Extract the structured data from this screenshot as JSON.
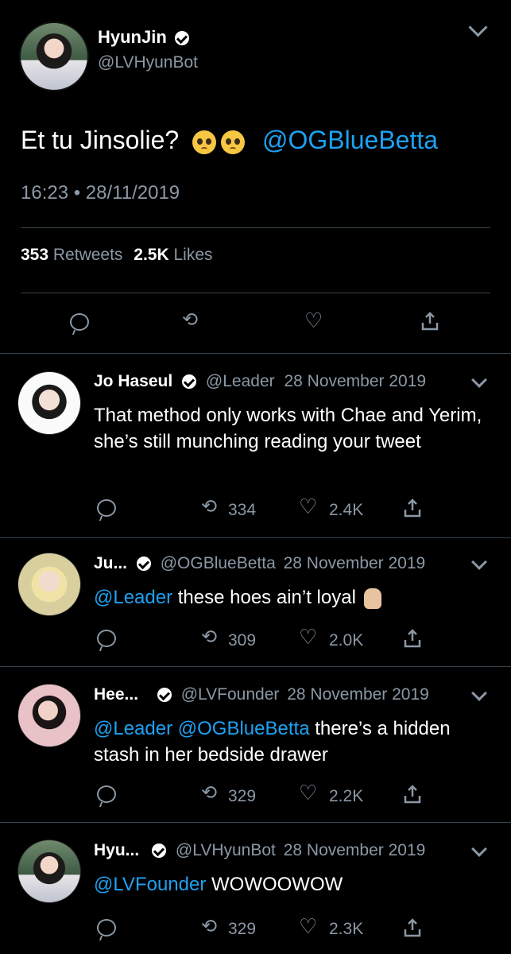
{
  "main": {
    "name": "HyunJin",
    "handle": "@LVHyunBot",
    "text": "Et tu Jinsolie?",
    "mention": "@OGBlueBetta",
    "timestamp": "16:23 • 28/11/2019",
    "retweets_count": "353",
    "retweets_label": "Retweets",
    "likes_count": "2.5K",
    "likes_label": "Likes"
  },
  "replies": [
    {
      "name": "Jo Haseul",
      "handle": "@Leader",
      "date": "28 November 2019",
      "text": "That method only works with Chae and Yerim, she’s still munching reading your tweet",
      "retweets": "334",
      "likes": "2.4K"
    },
    {
      "name": "Ju...",
      "handle": "@OGBlueBetta",
      "date": "28 November 2019",
      "mention": "@Leader",
      "text": " these hoes ain’t loyal",
      "retweets": "309",
      "likes": "2.0K"
    },
    {
      "name": "Hee...",
      "handle": "@LVFounder",
      "date": "28 November 2019",
      "mention": "@Leader @OGBlueBetta",
      "text": " there’s a hidden stash in her bedside drawer",
      "retweets": "329",
      "likes": "2.2K"
    },
    {
      "name": "Hyu...",
      "handle": "@LVHyunBot",
      "date": "28 November 2019",
      "mention": "@LVFounder",
      "text": " WOWOOWOW",
      "retweets": "329",
      "likes": "2.3K"
    }
  ],
  "colors": {
    "background": "#000000",
    "link": "#1da1f2",
    "secondary": "#8b98a5",
    "divider": "#38444d"
  }
}
